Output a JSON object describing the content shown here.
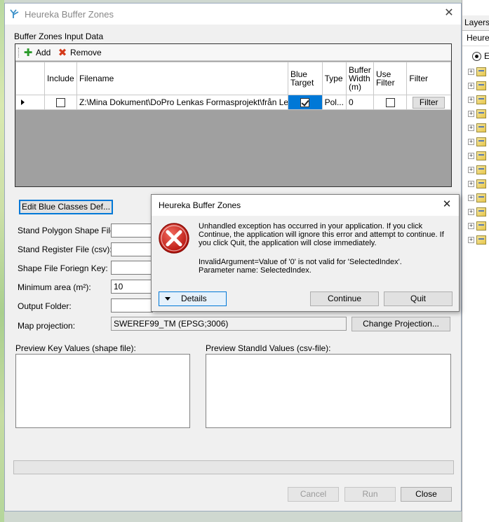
{
  "main_window": {
    "title": "Heureka Buffer Zones",
    "input_section_label": "Buffer Zones Input Data",
    "toolbar": {
      "add_label": "Add",
      "remove_label": "Remove"
    },
    "grid": {
      "columns": [
        "",
        "Include",
        "Filename",
        "Blue Target",
        "Type",
        "Buffer Width (m)",
        "Use Filter",
        "Filter"
      ],
      "rows": [
        {
          "include": false,
          "filename": "Z:\\Mina Dokument\\DoPro Lenkas Formasprojekt\\från Lenka...",
          "blue_target": true,
          "type": "Pol...",
          "buffer_width": "0",
          "use_filter": false,
          "filter_button": "Filter"
        }
      ]
    },
    "edit_blue_classes_button": "Edit Blue Classes Def...",
    "fields": {
      "stand_polygon_label": "Stand Polygon Shape File:",
      "stand_polygon_value": "",
      "stand_register_label": "Stand Register File (csv):",
      "stand_register_value": "",
      "foreign_key_label": "Shape File Foriegn Key:",
      "foreign_key_value": "",
      "min_area_label": "Minimum area (m²):",
      "min_area_value": "10",
      "output_folder_label": "Output Folder:",
      "output_folder_value": "",
      "map_projection_label": "Map projection:",
      "map_projection_value": "SWEREF99_TM (EPSG;3006)"
    },
    "change_projection_button": "Change Projection...",
    "preview_key_label": "Preview Key Values (shape file):",
    "preview_standid_label": "Preview StandId Values (csv-file):",
    "buttons": {
      "cancel": "Cancel",
      "run": "Run",
      "close": "Close"
    }
  },
  "error_dialog": {
    "title": "Heureka Buffer Zones",
    "message_lines": [
      "Unhandled exception has occurred in your application. If you click",
      "Continue, the application will ignore this error and attempt to continue. If",
      "you click Quit, the application will close immediately."
    ],
    "detail_lines": [
      "InvalidArgument=Value of '0' is not valid for 'SelectedIndex'.",
      "Parameter name: SelectedIndex."
    ],
    "details_button": "Details",
    "continue_button": "Continue",
    "quit_button": "Quit"
  },
  "background": {
    "layers_tab": "Layers",
    "layers_sub": "Heureka",
    "layers_radio_label": "E"
  },
  "colors": {
    "accent": "#0078d7",
    "error_red": "#d9261c",
    "add_green": "#2a9b2a",
    "remove_red": "#d43a1a"
  }
}
